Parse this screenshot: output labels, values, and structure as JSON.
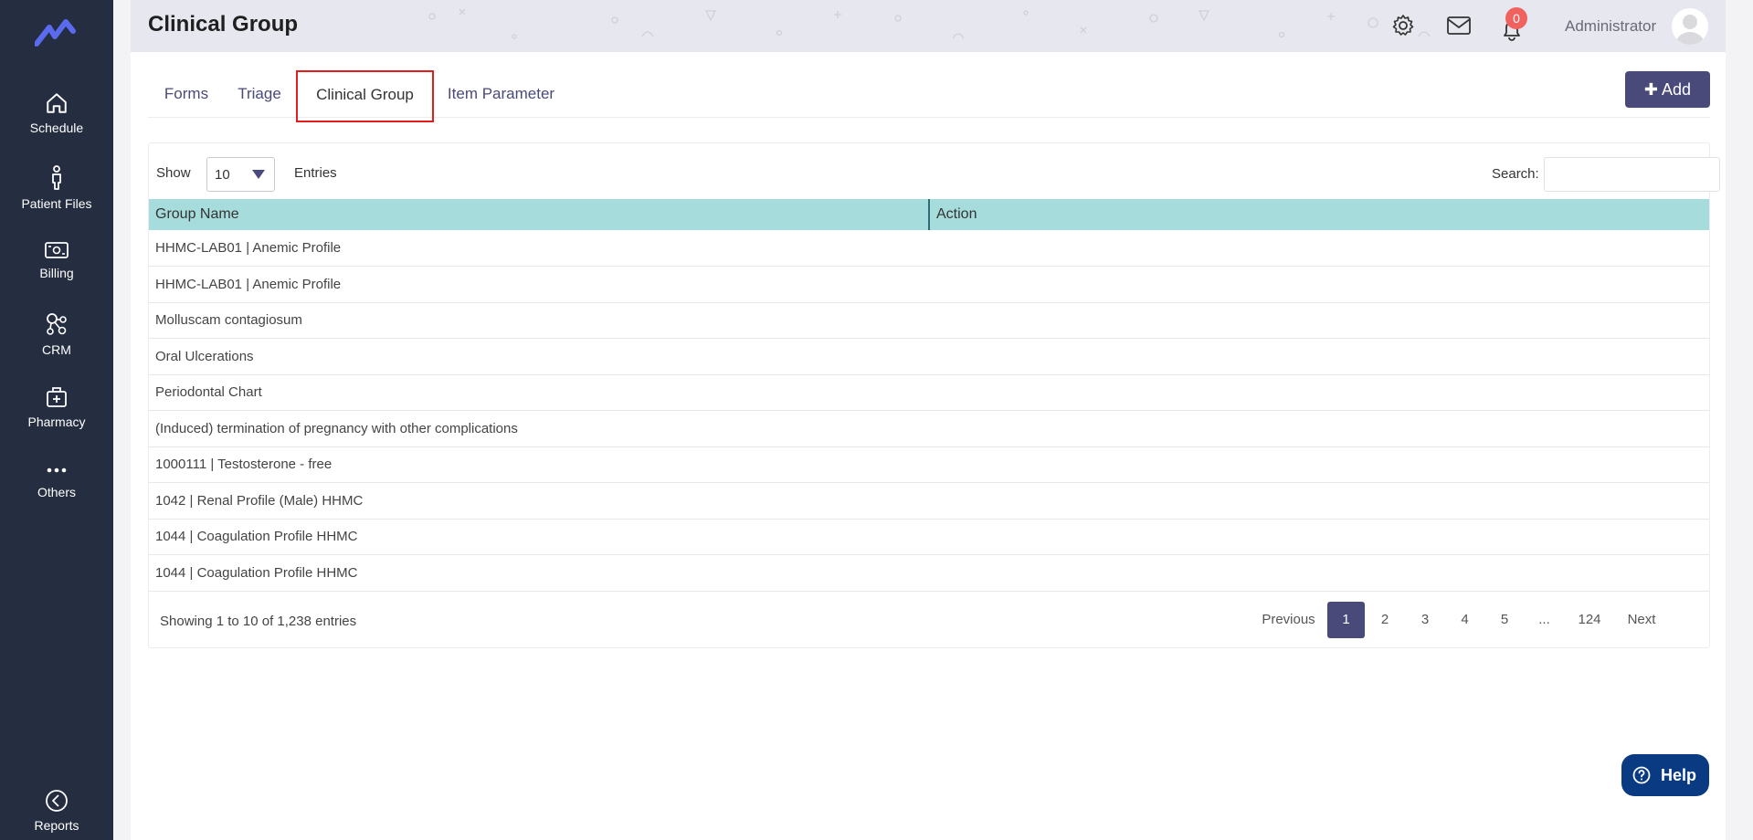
{
  "sidebar": {
    "items": [
      {
        "label": "Schedule",
        "icon": "home-icon"
      },
      {
        "label": "Patient Files",
        "icon": "person-icon"
      },
      {
        "label": "Billing",
        "icon": "money-icon"
      },
      {
        "label": "CRM",
        "icon": "network-icon"
      },
      {
        "label": "Pharmacy",
        "icon": "medical-bag-icon"
      },
      {
        "label": "Others",
        "icon": "more-dots-icon"
      },
      {
        "label": "Reports",
        "icon": "back-circle-icon"
      }
    ]
  },
  "header": {
    "title": "Clinical Group",
    "notification_count": "0",
    "user_name": "Administrator"
  },
  "tabs": [
    {
      "label": "Forms",
      "active": false
    },
    {
      "label": "Triage",
      "active": false
    },
    {
      "label": "Clinical Group",
      "active": true
    },
    {
      "label": "Item Parameter",
      "active": false
    }
  ],
  "toolbar": {
    "add_label": "Add"
  },
  "table_controls": {
    "show_label": "Show",
    "page_size": "10",
    "entries_label": "Entries",
    "search_label": "Search:",
    "search_value": ""
  },
  "table": {
    "columns": [
      "Group Name",
      "Action"
    ],
    "rows": [
      {
        "group_name": "HHMC-LAB01 | Anemic Profile",
        "action": ""
      },
      {
        "group_name": "HHMC-LAB01 | Anemic Profile",
        "action": ""
      },
      {
        "group_name": "Molluscam contagiosum",
        "action": ""
      },
      {
        "group_name": "Oral Ulcerations",
        "action": ""
      },
      {
        "group_name": "Periodontal Chart",
        "action": ""
      },
      {
        "group_name": "(Induced) termination of pregnancy with other complications",
        "action": ""
      },
      {
        "group_name": "1000111 | Testosterone - free",
        "action": ""
      },
      {
        "group_name": "1042 | Renal Profile (Male) HHMC",
        "action": ""
      },
      {
        "group_name": "1044 | Coagulation Profile HHMC",
        "action": ""
      },
      {
        "group_name": "1044 | Coagulation Profile HHMC",
        "action": ""
      }
    ]
  },
  "footer": {
    "info": "Showing 1 to 10 of 1,238 entries",
    "pagination": {
      "previous": "Previous",
      "pages": [
        "1",
        "2",
        "3",
        "4",
        "5",
        "...",
        "124"
      ],
      "current": "1",
      "next": "Next"
    }
  },
  "help": {
    "label": "Help"
  },
  "colors": {
    "sidebar": "#252d40",
    "accent": "#4a4a7a",
    "table_header": "#a7dcdc",
    "active_tab_border": "#e11d1d",
    "badge": "#f0625e",
    "help": "#0a3b82"
  }
}
